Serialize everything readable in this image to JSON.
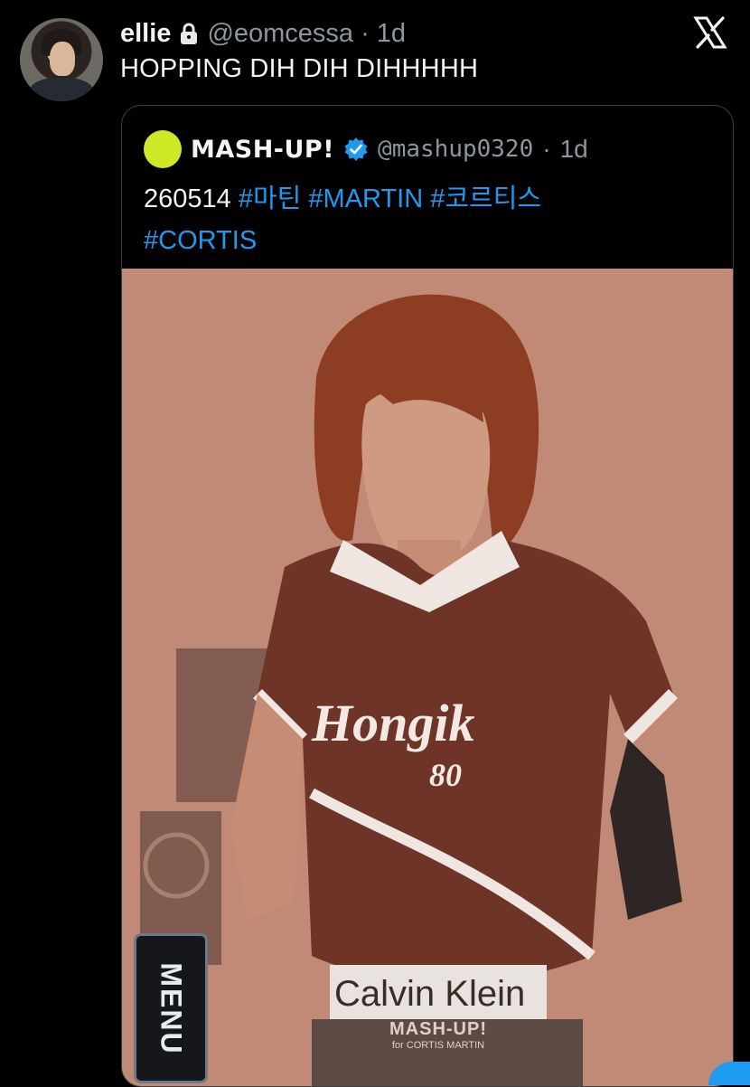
{
  "tweet": {
    "display_name": "ellie",
    "handle": "@eomcessa",
    "separator": "·",
    "time": "1d",
    "text": "HOPPING DIH DIH DIHHHHH"
  },
  "quoted_tweet": {
    "display_name": "MASH-UP!",
    "handle": "@mashup0320",
    "separator": "·",
    "time": "1d",
    "text_prefix": "260514",
    "hashtags": [
      "#마틴",
      "#MARTIN",
      "#코르티스",
      "#CORTIS"
    ],
    "photo": {
      "shirt_text": "Hongik",
      "shirt_number": "80",
      "waistband_text": "Calvin Klein",
      "menu_label": "MENU",
      "watermark_main": "MASH-UP!",
      "watermark_sub": "for CORTIS MARTIN"
    }
  },
  "icons": {
    "lock": "lock-icon",
    "verified": "verified-icon",
    "brand": "x-logo-icon"
  },
  "colors": {
    "background": "#000000",
    "link": "#1d9bf0",
    "muted": "#8e959c",
    "quote_avatar": "#cfe828"
  }
}
